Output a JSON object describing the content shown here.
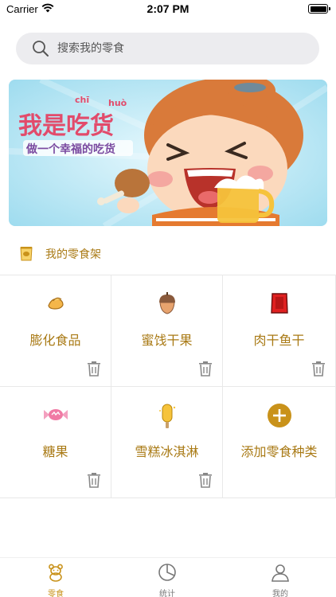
{
  "status_bar": {
    "carrier": "Carrier",
    "time": "2:07 PM"
  },
  "search": {
    "placeholder": "搜索我的零食"
  },
  "banner": {
    "title_text": "我是吃货",
    "pinyin_left": "chī",
    "pinyin_right": "huò",
    "subtitle_text": "做一个幸福的吃货"
  },
  "shelf": {
    "title": "我的零食架"
  },
  "categories": [
    {
      "label": "膨化食品",
      "icon": "chips-icon"
    },
    {
      "label": "蜜饯干果",
      "icon": "nut-icon"
    },
    {
      "label": "肉干鱼干",
      "icon": "meat-icon"
    },
    {
      "label": "糖果",
      "icon": "candy-icon"
    },
    {
      "label": "雪糕冰淇淋",
      "icon": "popsicle-icon"
    }
  ],
  "add_category": {
    "label": "添加零食种类",
    "icon": "plus-circle-icon"
  },
  "tabs": [
    {
      "label": "零食",
      "icon": "bear-icon",
      "active": true
    },
    {
      "label": "统计",
      "icon": "pie-chart-icon",
      "active": false
    },
    {
      "label": "我的",
      "icon": "person-icon",
      "active": false
    }
  ],
  "colors": {
    "accent": "#c9921a",
    "label_brown": "#a97a15",
    "search_bg": "#ececef"
  }
}
